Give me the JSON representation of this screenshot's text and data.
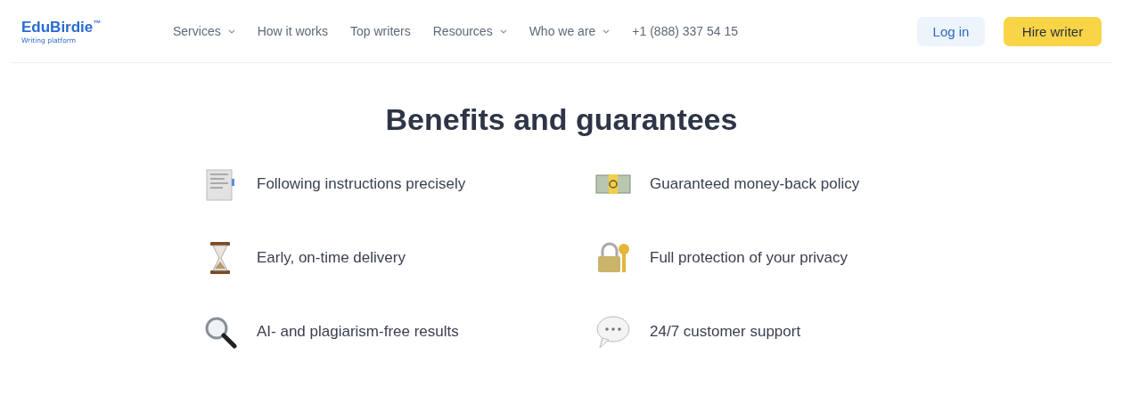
{
  "logo": {
    "name": "EduBirdie",
    "mark": "™",
    "tagline": "Writing platform"
  },
  "nav": [
    {
      "label": "Services",
      "dropdown": true
    },
    {
      "label": "How it works",
      "dropdown": false
    },
    {
      "label": "Top writers",
      "dropdown": false
    },
    {
      "label": "Resources",
      "dropdown": true
    },
    {
      "label": "Who we are",
      "dropdown": true
    },
    {
      "label": "+1 (888) 337 54 15",
      "dropdown": false
    }
  ],
  "buttons": [
    {
      "label": "Log in",
      "kind": "secondary"
    },
    {
      "label": "Hire writer",
      "kind": "primary"
    }
  ],
  "title": "Benefits and guarantees",
  "benefits": [
    {
      "kind": "document",
      "text": "Following instructions precisely"
    },
    {
      "kind": "money",
      "text": "Guaranteed money-back policy"
    },
    {
      "kind": "hourglass",
      "text": "Early, on-time delivery"
    },
    {
      "kind": "lock",
      "text": "Full protection of your privacy"
    },
    {
      "kind": "magnifier",
      "text": "AI- and plagiarism-free results"
    },
    {
      "kind": "speech",
      "text": "24/7 customer support"
    }
  ]
}
